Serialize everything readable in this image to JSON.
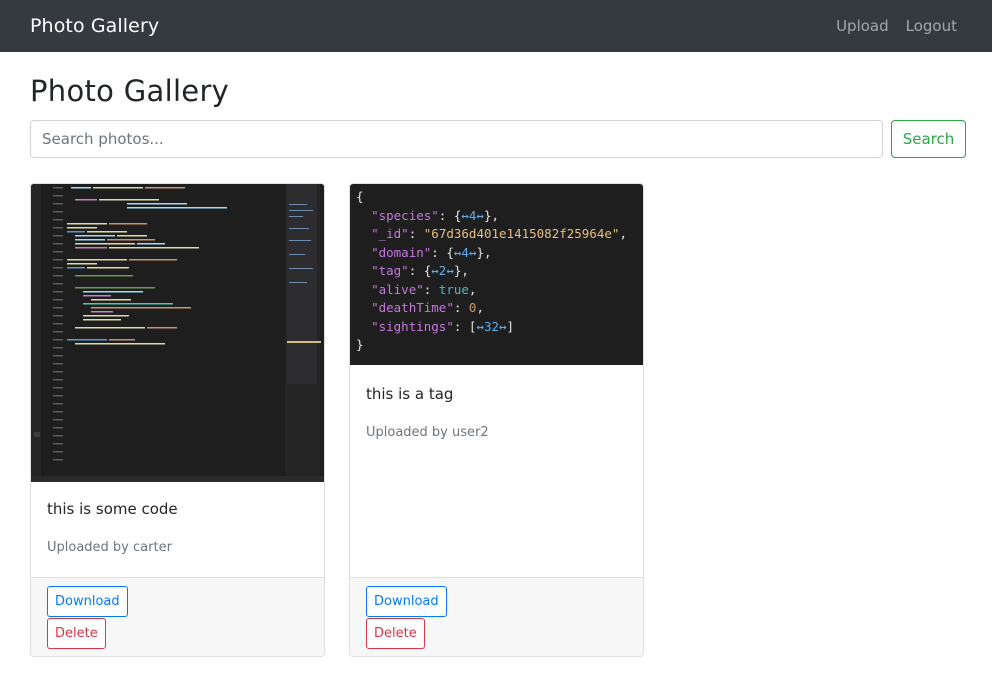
{
  "navbar": {
    "brand": "Photo Gallery",
    "links": [
      "Upload",
      "Logout"
    ]
  },
  "page": {
    "title": "Photo Gallery"
  },
  "search": {
    "placeholder": "Search photos...",
    "value": "",
    "button_label": "Search"
  },
  "cards": [
    {
      "title": "this is some code",
      "uploaded_by": "Uploaded by carter",
      "download_label": "Download",
      "delete_label": "Delete",
      "image_kind": "code-editor-screenshot"
    },
    {
      "title": "this is a tag",
      "uploaded_by": "Uploaded by user2",
      "download_label": "Download",
      "delete_label": "Delete",
      "image_kind": "json-screenshot",
      "json_lines": [
        "{",
        "  \"species\": {↔4↔},",
        "  \"_id\": \"67d36d401e1415082f25964e\",",
        "  \"domain\": {↔4↔},",
        "  \"tag\": {↔2↔},",
        "  \"alive\": true,",
        "  \"deathTime\": 0,",
        "  \"sightings\": [↔32↔]",
        "}"
      ]
    }
  ],
  "colors": {
    "navbar_bg": "#343a40",
    "search_button": "#28a745",
    "download_button": "#007bff",
    "delete_button": "#dc3545"
  }
}
